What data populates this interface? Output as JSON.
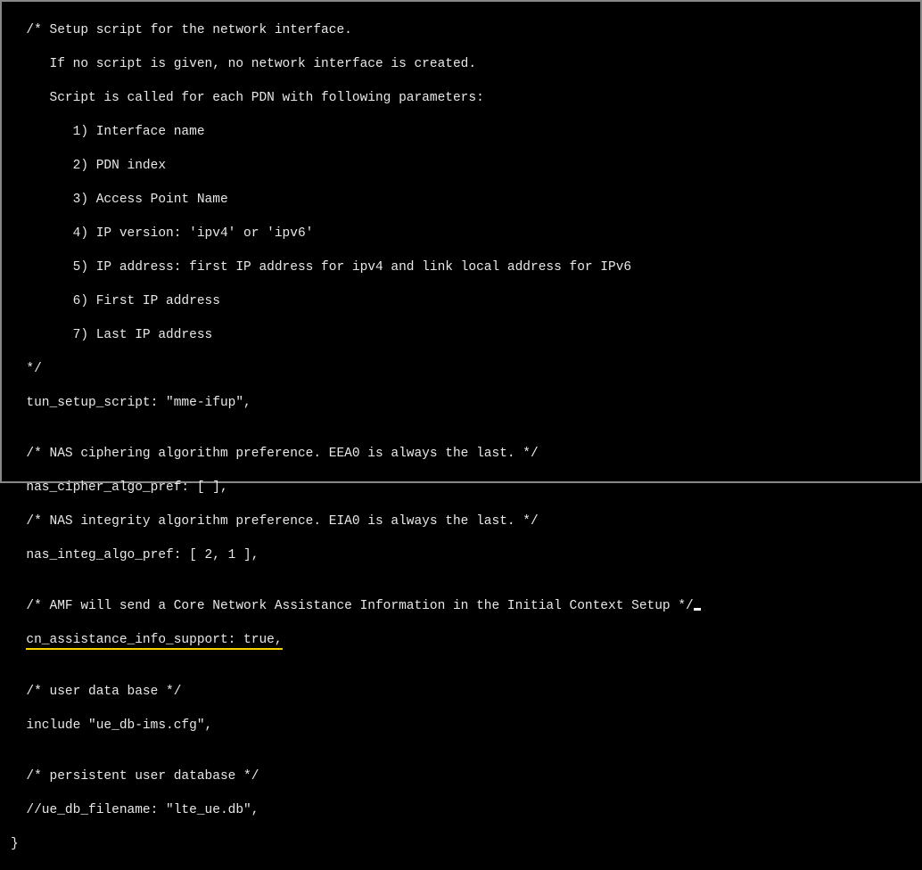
{
  "lines": {
    "l0": "  /* Setup script for the network interface.",
    "l1": "     If no script is given, no network interface is created.",
    "l2": "     Script is called for each PDN with following parameters:",
    "l3": "        1) Interface name",
    "l4": "        2) PDN index",
    "l5": "        3) Access Point Name",
    "l6": "        4) IP version: 'ipv4' or 'ipv6'",
    "l7": "        5) IP address: first IP address for ipv4 and link local address for IPv6",
    "l8": "        6) First IP address",
    "l9": "        7) Last IP address",
    "l10": "  */",
    "l11": "  tun_setup_script: \"mme-ifup\",",
    "l12": "",
    "l13": "  /* NAS ciphering algorithm preference. EEA0 is always the last. */",
    "l14": "  nas_cipher_algo_pref: [ ],",
    "l15": "  /* NAS integrity algorithm preference. EIA0 is always the last. */",
    "l16": "  nas_integ_algo_pref: [ 2, 1 ],",
    "l17": "",
    "l18": "  /* AMF will send a Core Network Assistance Information in the Initial Context Setup */",
    "l19a": "  ",
    "l19b": "cn_assistance_info_support: true,",
    "l20": "",
    "l21": "  /* user data base */",
    "l22": "  include \"ue_db-ims.cfg\",",
    "l23": "",
    "l24": "  /* persistent user database */",
    "l25": "  //ue_db_filename: \"lte_ue.db\",",
    "l26": "}"
  }
}
